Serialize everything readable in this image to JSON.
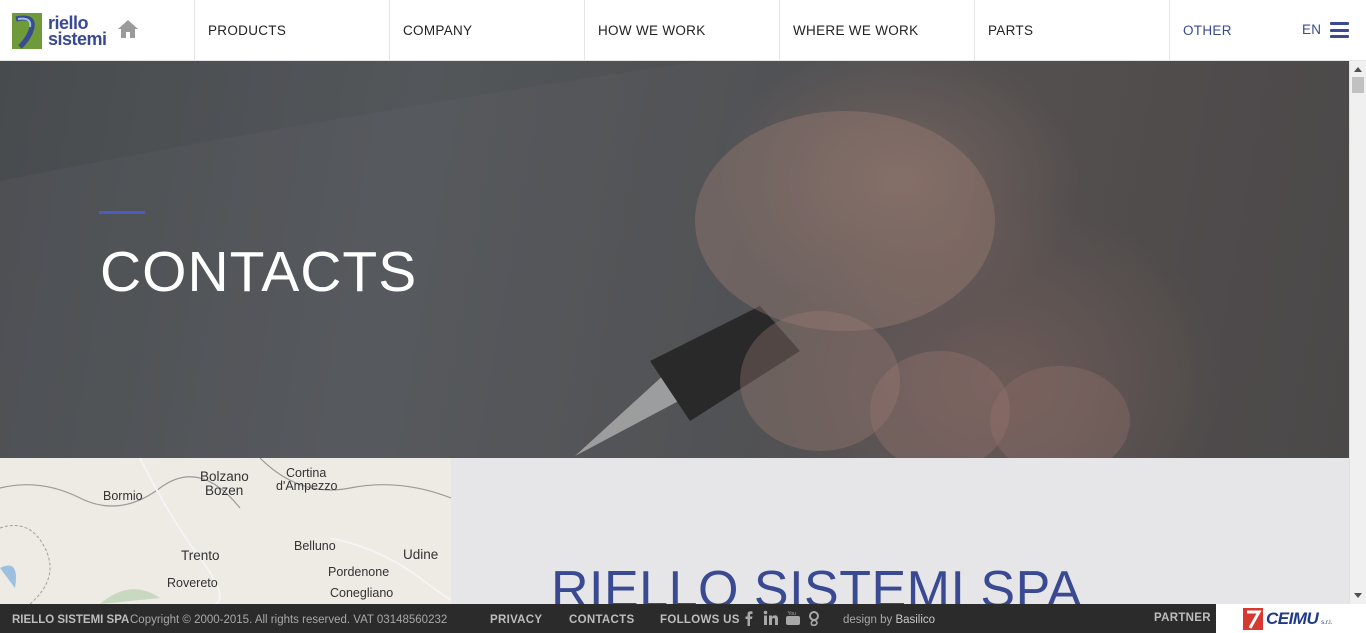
{
  "header": {
    "logo_text_line1": "riello",
    "logo_text_line2": "sistemi",
    "nav": [
      {
        "label": "PRODUCTS"
      },
      {
        "label": "COMPANY"
      },
      {
        "label": "HOW WE WORK"
      },
      {
        "label": "WHERE WE WORK"
      },
      {
        "label": "PARTS"
      },
      {
        "label": "OTHER"
      }
    ],
    "language": "EN"
  },
  "hero": {
    "title": "CONTACTS"
  },
  "map": {
    "places": [
      {
        "name": "Bolzano"
      },
      {
        "name": "Bozen"
      },
      {
        "name": "Cortina"
      },
      {
        "name": "d'Ampezzo"
      },
      {
        "name": "Bormio"
      },
      {
        "name": "Belluno"
      },
      {
        "name": "Trento"
      },
      {
        "name": "Udine"
      },
      {
        "name": "Pordenone"
      },
      {
        "name": "Rovereto"
      },
      {
        "name": "Conegliano"
      }
    ]
  },
  "company": {
    "name": "RIELLO SISTEMI SPA"
  },
  "footer": {
    "company": "RIELLO SISTEMI SPA",
    "copyright": "Copyright © 2000-2015. All rights reserved. VAT 03148560232",
    "privacy": "PRIVACY",
    "contacts": "CONTACTS",
    "follow": "FOLLOWS US",
    "design_prefix": "design by",
    "designer": "Basilico",
    "partner": "PARTNER",
    "partner_brand": "CEIMU",
    "partner_suffix": "s.r.l."
  },
  "icons": [
    "home-icon",
    "menu-icon",
    "facebook-icon",
    "linkedin-icon",
    "youtube-icon",
    "google-plus-icon"
  ],
  "colors": {
    "brand": "#3a4a92",
    "accent": "#4a5cc0",
    "footer_bg": "#2b2b2b"
  }
}
